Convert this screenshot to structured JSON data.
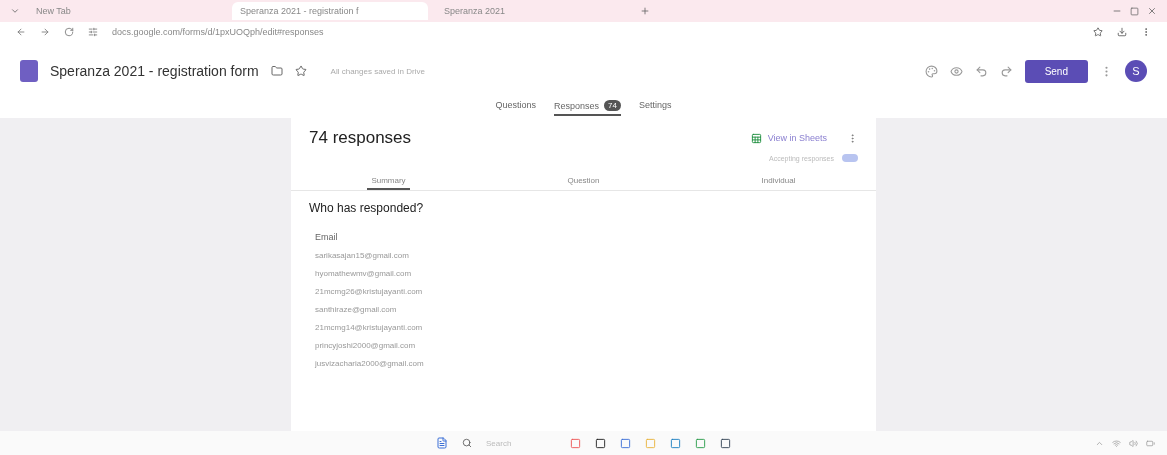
{
  "browser": {
    "tabs": [
      {
        "label": "New Tab",
        "selected": false
      },
      {
        "label": "Speranza 2021 - registration f",
        "selected": true
      },
      {
        "label": "Speranza 2021",
        "selected": false
      }
    ],
    "address": "docs.google.com/forms/d/1pxUOQph/edit#responses"
  },
  "header": {
    "title": "Speranza 2021 - registration form",
    "save_status": "All changes saved in Drive",
    "send": "Send",
    "avatar": "S"
  },
  "form_tabs": [
    {
      "label": "Questions",
      "selected": false
    },
    {
      "label": "Responses",
      "badge": "74",
      "selected": true
    },
    {
      "label": "Settings",
      "selected": false
    }
  ],
  "card": {
    "heading": "74 responses",
    "sheets_link": "View in Sheets",
    "accepting": {
      "label": "Accepting responses",
      "on": true
    },
    "view_tabs": [
      {
        "label": "Summary",
        "selected": true
      },
      {
        "label": "Question",
        "selected": false
      },
      {
        "label": "Individual",
        "selected": false
      }
    ]
  },
  "respondents": {
    "heading": "Who has responded?",
    "column": "Email",
    "emails": [
      "sarikasajan15@gmail.com",
      "hyomathewmv@gmail.com",
      "21mcmg26@kristujayanti.com",
      "santhiraze@gmail.com",
      "21mcmg14@kristujayanti.com",
      "princyjoshi2000@gmail.com",
      "jusvizacharia2000@gmail.com"
    ]
  },
  "taskbar": {
    "search": "Search"
  }
}
